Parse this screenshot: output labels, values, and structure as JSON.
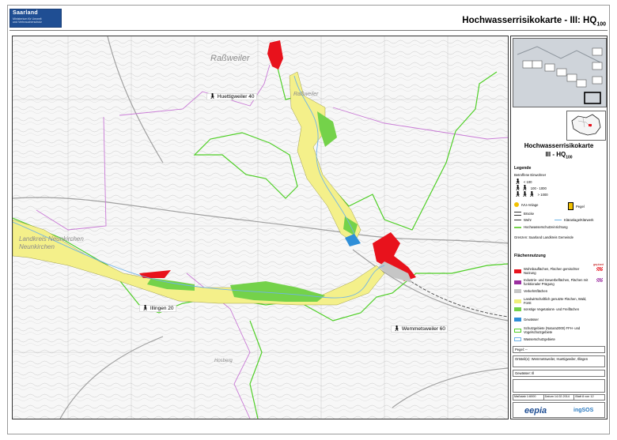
{
  "header": {
    "logo_name": "Saarland",
    "logo_sub": "Ministerium für Umwelt\nund Verbraucherschutz",
    "title": "Hochwasserrisikokarte - III: HQ",
    "title_sub": "100"
  },
  "map": {
    "places": [
      {
        "label": "Huettigweiler 40",
        "icon": "person-icon"
      },
      {
        "label": "Illingen 20",
        "icon": "person-icon"
      },
      {
        "label": "Wemmetsweiler 60",
        "icon": "person-icon"
      }
    ],
    "towns": [
      "Raßweiler",
      "Raßweiler",
      "Landkreis Neunkirchen",
      "Neunkirchen",
      "Hosberg"
    ]
  },
  "panel": {
    "title_line1": "Hochwasserrisikokarte",
    "title_line2": "III - HQ",
    "title_sub": "100",
    "legend_label": "Legende",
    "betroffene_label": "Betroffene Einwohner",
    "residents": [
      "< 100",
      "100 - 1000",
      "> 1000"
    ],
    "ivu_label": "IVU-Anlage",
    "pegel_label": "Pegel",
    "bruecke_label": "Brücke",
    "wehr_label": "Wehr",
    "klaerwerk_label": "Kläranlage/Klärwerk",
    "hws_label": "Hochwasserschutzeinrichtung",
    "grenzen": "Grenzen: Saarland  Landkreis  Gemeinde",
    "flaechen_label": "Flächennutzung",
    "geplant_label": "geplant",
    "landuse": [
      {
        "label": "Wohnbauflächen, Flächen gemischter Nutzung",
        "color": "#e8121c"
      },
      {
        "label": "Industrie- und Gewerbeflächen, Flächen mit funktionaler Prägung",
        "color": "#9b2fa0"
      },
      {
        "label": "Verkehrsflächen",
        "color": "#c6c6c6"
      },
      {
        "label": "Landwirtschaftlich genutzte Flächen, Wald, Forst",
        "color": "#f0f07a"
      },
      {
        "label": "sonstige Vegetations- und Freiflächen",
        "color": "#74d24a"
      },
      {
        "label": "Gewässer",
        "color": "#2f8fd8"
      }
    ],
    "schutz_label": "Schutzgebiete (Natura2000) FFH- und Vogelschutzgebiete",
    "wasserschutz_label": "Wasserschutzgebiete",
    "pegel_field": "Pegel: --",
    "ortsteil": "Ortsteil(e): Wemmetsweiler, Huettigweiler, Illingen",
    "gewaesser": "Gewässer: Ill",
    "bottom": [
      "Maßstab 1:6000",
      "Datum 14.02.2014",
      "Blatt 8 von 12"
    ],
    "logo_epic": "eepia",
    "logo_right": "ingSOS"
  },
  "colors": {
    "hq100_flood": "#f4f08a",
    "residential": "#e8121c",
    "vegetation": "#74d24a",
    "water": "#2f8fd8",
    "boundary_green": "#4fcf26",
    "municipal_border": "#c97ad6"
  }
}
